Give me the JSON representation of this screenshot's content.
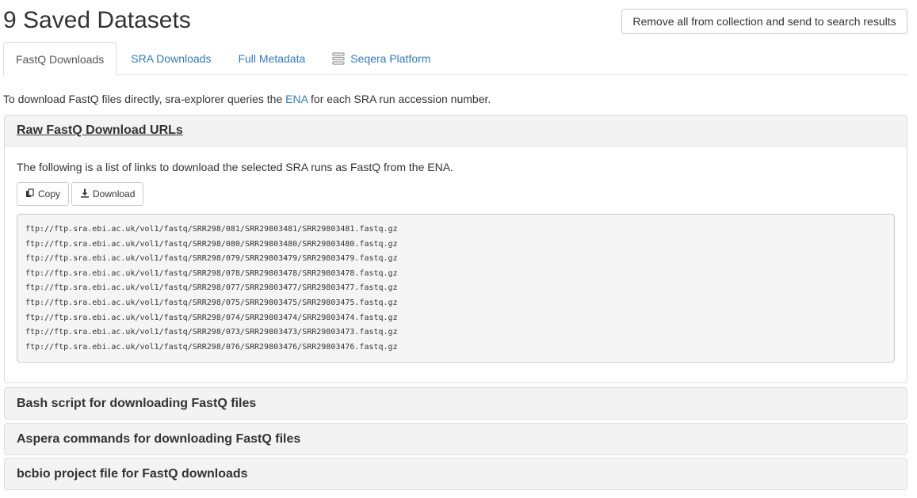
{
  "page": {
    "title": "9 Saved Datasets",
    "remove_button_label": "Remove all from collection and send to search results"
  },
  "tabs": [
    {
      "label": "FastQ Downloads",
      "active": true
    },
    {
      "label": "SRA Downloads",
      "active": false
    },
    {
      "label": "Full Metadata",
      "active": false
    },
    {
      "label": "Seqera Platform",
      "active": false,
      "icon": "seqera-icon"
    }
  ],
  "intro": {
    "before": "To download FastQ files directly, sra-explorer queries the ",
    "link": "ENA",
    "after": " for each SRA run accession number."
  },
  "raw_panel": {
    "title": "Raw FastQ Download URLs",
    "description": "The following is a list of links to download the selected SRA runs as FastQ from the ENA.",
    "copy_label": "Copy",
    "download_label": "Download",
    "urls": [
      "ftp://ftp.sra.ebi.ac.uk/vol1/fastq/SRR298/081/SRR29803481/SRR29803481.fastq.gz",
      "ftp://ftp.sra.ebi.ac.uk/vol1/fastq/SRR298/080/SRR29803480/SRR29803480.fastq.gz",
      "ftp://ftp.sra.ebi.ac.uk/vol1/fastq/SRR298/079/SRR29803479/SRR29803479.fastq.gz",
      "ftp://ftp.sra.ebi.ac.uk/vol1/fastq/SRR298/078/SRR29803478/SRR29803478.fastq.gz",
      "ftp://ftp.sra.ebi.ac.uk/vol1/fastq/SRR298/077/SRR29803477/SRR29803477.fastq.gz",
      "ftp://ftp.sra.ebi.ac.uk/vol1/fastq/SRR298/075/SRR29803475/SRR29803475.fastq.gz",
      "ftp://ftp.sra.ebi.ac.uk/vol1/fastq/SRR298/074/SRR29803474/SRR29803474.fastq.gz",
      "ftp://ftp.sra.ebi.ac.uk/vol1/fastq/SRR298/073/SRR29803473/SRR29803473.fastq.gz",
      "ftp://ftp.sra.ebi.ac.uk/vol1/fastq/SRR298/076/SRR29803476/SRR29803476.fastq.gz"
    ]
  },
  "collapsed_panels": [
    {
      "title": "Bash script for downloading FastQ files"
    },
    {
      "title": "Aspera commands for downloading FastQ files"
    },
    {
      "title": "bcbio project file for FastQ downloads"
    }
  ],
  "colors": {
    "link": "#337ab7",
    "panel_heading_bg": "#f3f3f3",
    "code_bg": "#f5f5f5",
    "border": "#dddddd"
  }
}
